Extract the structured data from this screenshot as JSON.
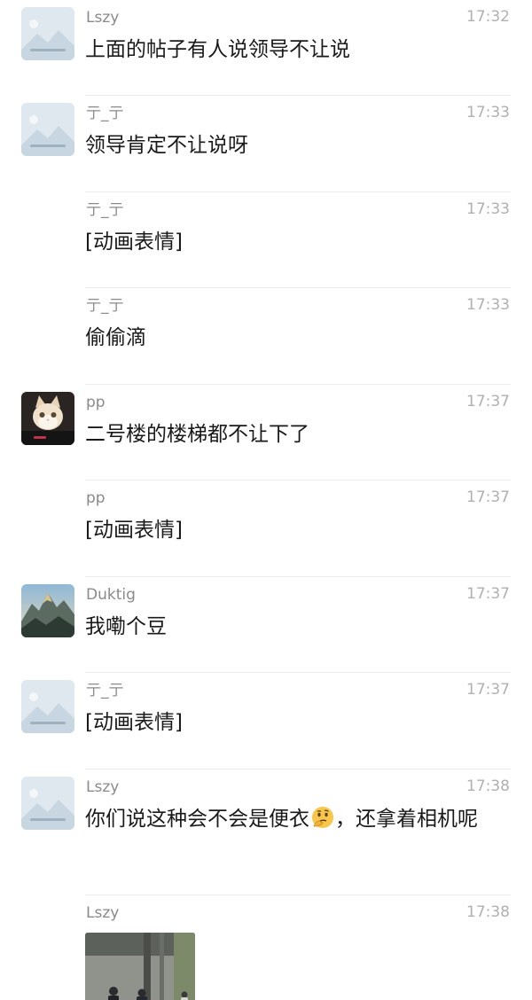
{
  "messages": [
    {
      "sender": "Lszy",
      "time": "17:32",
      "text": "上面的帖子有人说领导不让说",
      "avatar": "placeholder-avatar-icon"
    },
    {
      "sender": "亍_亍",
      "time": "17:33",
      "text": "领导肯定不让说呀",
      "avatar": "placeholder-avatar-icon"
    },
    {
      "sender": "亍_亍",
      "time": "17:33",
      "text": "[动画表情]",
      "avatar": ""
    },
    {
      "sender": "亍_亍",
      "time": "17:33",
      "text": "偷偷滴",
      "avatar": ""
    },
    {
      "sender": "pp",
      "time": "17:37",
      "text": "二号楼的楼梯都不让下了",
      "avatar": "cat-avatar-icon"
    },
    {
      "sender": "pp",
      "time": "17:37",
      "text": "[动画表情]",
      "avatar": ""
    },
    {
      "sender": "Duktig",
      "time": "17:37",
      "text": "我嘞个豆",
      "avatar": "mountain-avatar-icon"
    },
    {
      "sender": "亍_亍",
      "time": "17:37",
      "text": "[动画表情]",
      "avatar": "placeholder-avatar-icon"
    },
    {
      "sender": "Lszy",
      "time": "17:38",
      "text_before": "你们说这种会不会是便衣",
      "emoji": "thinking-face-emoji",
      "text_after": "，还拿着相机呢",
      "avatar": "placeholder-avatar-icon"
    },
    {
      "sender": "Lszy",
      "time": "17:38",
      "image": "street-photo",
      "avatar": ""
    }
  ]
}
